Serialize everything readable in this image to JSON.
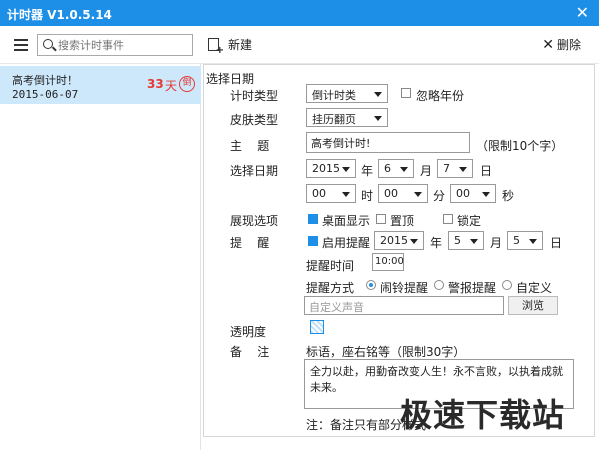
{
  "window": {
    "title": "计时器 V1.0.5.14",
    "close_glyph": "✕"
  },
  "toolbar": {
    "search_placeholder": "搜索计时事件",
    "new_label": "新建",
    "delete_label": "删除",
    "delete_glyph": "✕"
  },
  "list": {
    "items": [
      {
        "name": "高考倒计时！",
        "date": "2015-06-07",
        "days": "33",
        "day_unit": "天",
        "badge": "倒"
      }
    ]
  },
  "form": {
    "section_title": "选择日期",
    "timer_type": {
      "label": "计时类型",
      "value": "倒计时类",
      "ignore_year_label": "忽略年份"
    },
    "skin_type": {
      "label": "皮肤类型",
      "value": "挂历翻页"
    },
    "subject": {
      "label": "主    题",
      "value": "高考倒计时!",
      "hint": "（限制10个字）"
    },
    "select_date": {
      "label": "选择日期",
      "year": "2015",
      "year_unit": "年",
      "month": "6",
      "month_unit": "月",
      "day": "7",
      "day_unit": "日",
      "hour": "00",
      "hour_unit": "时",
      "minute": "00",
      "minute_unit": "分",
      "second": "00",
      "second_unit": "秒"
    },
    "display": {
      "label": "展现选项",
      "desktop_label": "桌面显示",
      "top_label": "置顶",
      "lock_label": "锁定"
    },
    "reminder": {
      "label": "提    醒",
      "enable_label": "启用提醒",
      "year": "2015",
      "year_unit": "年",
      "month": "5",
      "month_unit": "月",
      "day": "5",
      "day_unit": "日",
      "time_label": "提醒时间",
      "time_value": "10:00",
      "mode_label": "提醒方式",
      "mode_bell": "闹铃提醒",
      "mode_alarm": "警报提醒",
      "mode_custom": "自定义",
      "sound_placeholder": "自定义声音",
      "browse_label": "浏览"
    },
    "opacity": {
      "label": "透明度"
    },
    "note": {
      "label": "备    注",
      "hint": "标语，座右铭等（限制30字）",
      "value": "全力以赴，用勤奋改变人生！永不言败，以执着成就未来。",
      "footer": "注：备注只有部分样式"
    }
  },
  "watermark": "极速下载站"
}
